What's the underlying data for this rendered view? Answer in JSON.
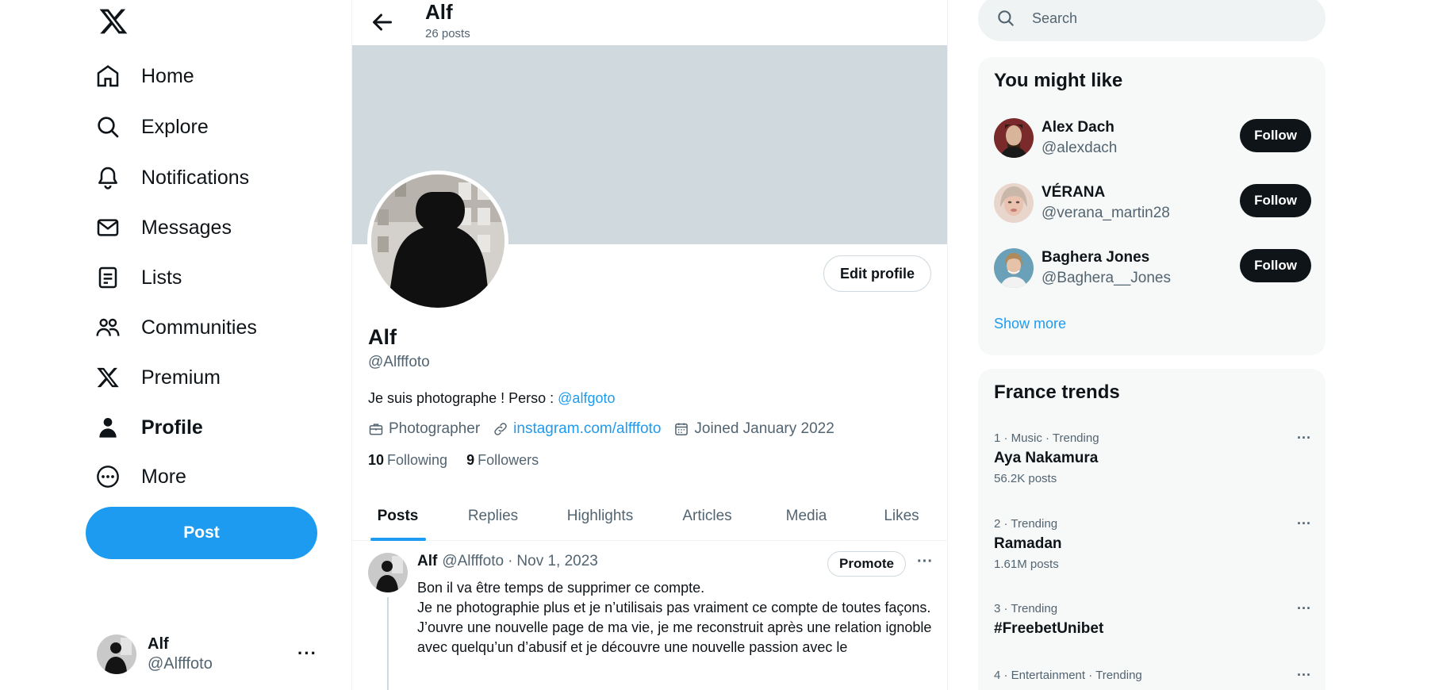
{
  "nav": {
    "logo_icon": "x-logo-icon",
    "items": [
      {
        "label": "Home",
        "icon": "home-icon"
      },
      {
        "label": "Explore",
        "icon": "search-icon"
      },
      {
        "label": "Notifications",
        "icon": "bell-icon"
      },
      {
        "label": "Messages",
        "icon": "mail-icon"
      },
      {
        "label": "Lists",
        "icon": "list-icon"
      },
      {
        "label": "Communities",
        "icon": "communities-icon"
      },
      {
        "label": "Premium",
        "icon": "x-logo-icon"
      },
      {
        "label": "Profile",
        "icon": "person-icon",
        "active": true
      },
      {
        "label": "More",
        "icon": "more-circle-icon"
      }
    ],
    "post_label": "Post",
    "account": {
      "name": "Alf",
      "handle": "@Alfffoto",
      "more": "···"
    }
  },
  "header": {
    "name": "Alf",
    "post_count": "26 posts"
  },
  "profile": {
    "edit_label": "Edit profile",
    "name": "Alf",
    "handle": "@Alfffoto",
    "bio_text": "Je suis photographe ! Perso : ",
    "bio_link": "@alfgoto",
    "occupation": "Photographer",
    "website": "instagram.com/alfffoto",
    "joined": "Joined January 2022",
    "following_count": "10",
    "following_label": "Following",
    "followers_count": "9",
    "followers_label": "Followers"
  },
  "tabs": [
    {
      "label": "Posts",
      "active": true
    },
    {
      "label": "Replies"
    },
    {
      "label": "Highlights"
    },
    {
      "label": "Articles"
    },
    {
      "label": "Media"
    },
    {
      "label": "Likes"
    }
  ],
  "tweet": {
    "name": "Alf",
    "handle": "@Alfffoto",
    "separator": "·",
    "date": "Nov 1, 2023",
    "promote_label": "Promote",
    "more": "···",
    "lines": [
      "Bon il va être temps de supprimer ce compte.",
      "Je ne photographie plus et je n’utilisais pas vraiment ce compte de toutes façons.",
      "J’ouvre une nouvelle page de ma vie, je me reconstruit après une relation ignoble avec quelqu’un d’abusif et je découvre une nouvelle passion avec le"
    ]
  },
  "search": {
    "placeholder": "Search"
  },
  "suggestions": {
    "title": "You might like",
    "follow_label": "Follow",
    "show_more": "Show more",
    "users": [
      {
        "name": "Alex Dach",
        "handle": "@alexdach",
        "avatar_color": "#7a2a2a"
      },
      {
        "name": "VÉRANA",
        "handle": "@verana_martin28",
        "avatar_color": "#d9b3a8"
      },
      {
        "name": "Baghera Jones",
        "handle": "@Baghera__Jones",
        "avatar_color": "#6aa0b8"
      }
    ]
  },
  "trends": {
    "title": "France trends",
    "more": "···",
    "items": [
      {
        "meta": "1 · Music · Trending",
        "topic": "Aya Nakamura",
        "count": "56.2K posts"
      },
      {
        "meta": "2 · Trending",
        "topic": "Ramadan",
        "count": "1.61M posts"
      },
      {
        "meta": "3 · Trending",
        "topic": "#FreebetUnibet",
        "count": ""
      },
      {
        "meta": "4 · Entertainment · Trending",
        "topic": "",
        "count": ""
      }
    ]
  },
  "colors": {
    "accent": "#1d9bf0",
    "text": "#0f1419",
    "muted": "#536471",
    "banner": "#cfd9de"
  }
}
